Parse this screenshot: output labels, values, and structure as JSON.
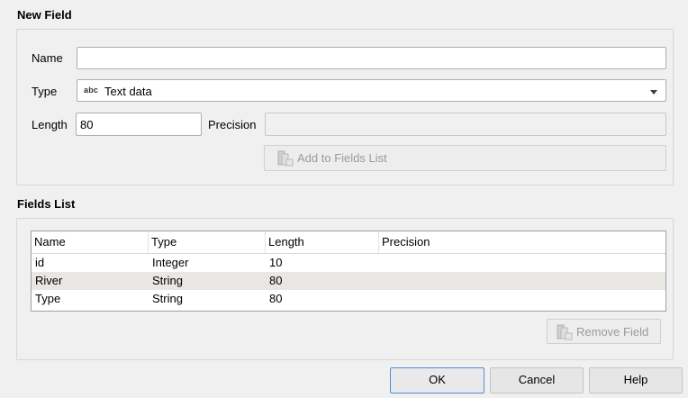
{
  "new_field": {
    "title": "New Field",
    "name_label": "Name",
    "name_value": "",
    "type_label": "Type",
    "type_icon": "abc",
    "type_value": "Text data",
    "length_label": "Length",
    "length_value": "80",
    "precision_label": "Precision",
    "precision_value": "",
    "add_button_label": "Add to Fields List"
  },
  "fields_list": {
    "title": "Fields List",
    "columns": [
      "Name",
      "Type",
      "Length",
      "Precision"
    ],
    "rows": [
      {
        "name": "id",
        "type": "Integer",
        "length": "10",
        "precision": ""
      },
      {
        "name": "River",
        "type": "String",
        "length": "80",
        "precision": ""
      },
      {
        "name": "Type",
        "type": "String",
        "length": "80",
        "precision": ""
      }
    ],
    "remove_button_label": "Remove Field"
  },
  "footer": {
    "ok_label": "OK",
    "cancel_label": "Cancel",
    "help_label": "Help"
  }
}
